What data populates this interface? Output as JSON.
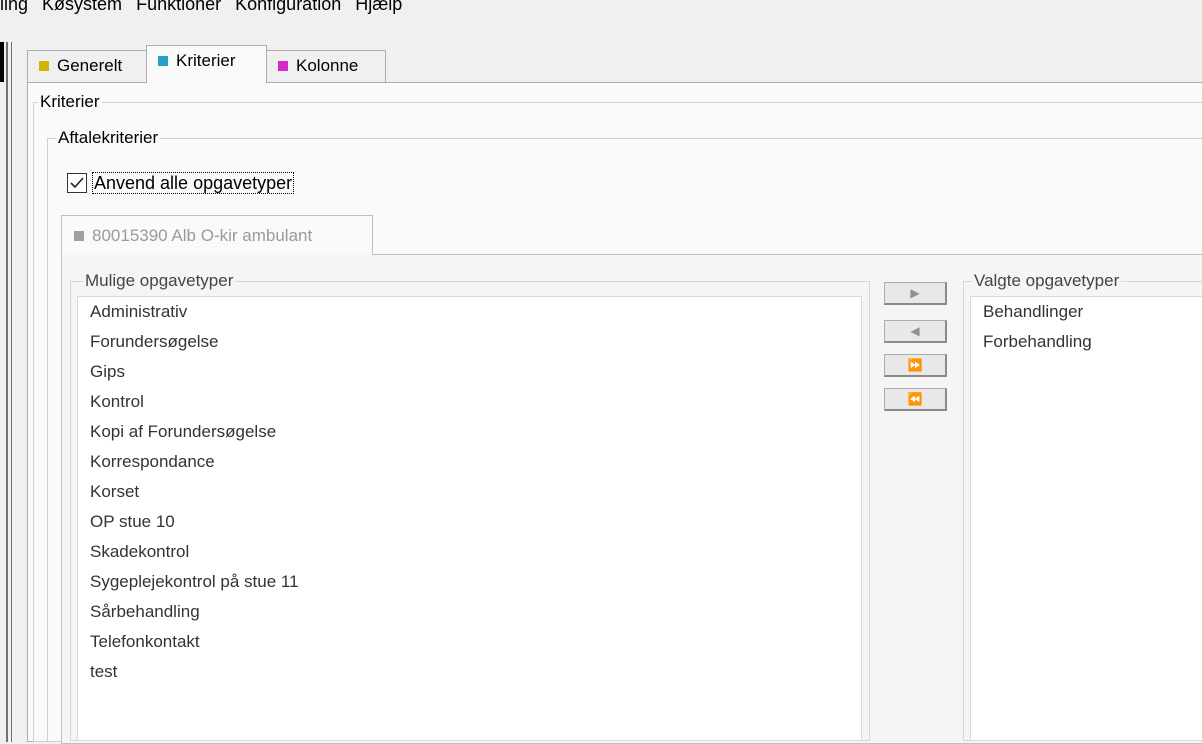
{
  "menubar": {
    "items": [
      "ling",
      "Køsystem",
      "Funktioner",
      "Konfiguration",
      "Hjælp"
    ]
  },
  "tabs": [
    {
      "label": "Generelt",
      "color": "#d4b400"
    },
    {
      "label": "Kriterier",
      "color": "#2aa0c8"
    },
    {
      "label": "Kolonne",
      "color": "#d42ac8"
    }
  ],
  "criteria": {
    "group_title": "Kriterier",
    "sub_group_title": "Aftalekriterier",
    "checkbox_label": "Anvend alle opgavetyper",
    "checkbox_checked": true,
    "sub_tab_label": "80015390 Alb O-kir ambulant"
  },
  "available": {
    "title": "Mulige opgavetyper",
    "items": [
      "Administrativ",
      "Forundersøgelse",
      "Gips",
      "Kontrol",
      "Kopi af Forundersøgelse",
      "Korrespondance",
      "Korset",
      "OP stue 10",
      "Skadekontrol",
      "Sygeplejekontrol på stue 11",
      "Sårbehandling",
      "Telefonkontakt",
      "test"
    ]
  },
  "selected": {
    "title": "Valgte opgavetyper",
    "items": [
      "Behandlinger",
      "Forbehandling"
    ]
  },
  "move_buttons": {
    "add": "▶",
    "remove": "◀",
    "add_all": "⏩",
    "remove_all": "⏪"
  }
}
